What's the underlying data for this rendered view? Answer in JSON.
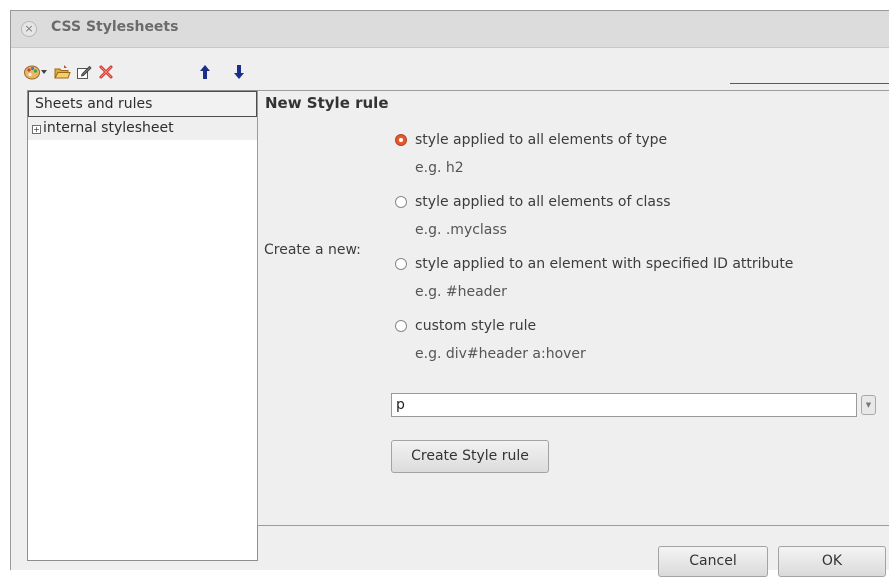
{
  "window": {
    "title": "CSS Stylesheets",
    "close_glyph": "×"
  },
  "toolbar": {
    "icons": [
      "palette-icon",
      "dropdown-arrow-icon",
      "open-folder-icon",
      "edit-icon",
      "delete-icon",
      "move-up-icon",
      "move-down-icon"
    ]
  },
  "tree": {
    "header": "Sheets and rules",
    "items": [
      {
        "label": "internal stylesheet",
        "expander": "+"
      }
    ]
  },
  "form": {
    "title": "New Style rule",
    "create_label": "Create a new:",
    "options": [
      {
        "label": "style applied to all elements of type",
        "example": "e.g. h2",
        "selected": true
      },
      {
        "label": "style applied to all elements of class",
        "example": "e.g. .myclass",
        "selected": false
      },
      {
        "label": "style applied to an element with specified ID attribute",
        "example": "e.g. #header",
        "selected": false
      },
      {
        "label": "custom style rule",
        "example": "e.g. div#header a:hover",
        "selected": false
      }
    ],
    "selector_value": "p",
    "create_button": "Create Style rule"
  },
  "buttons": {
    "cancel": "Cancel",
    "ok": "OK"
  },
  "colors": {
    "radio_selected": "#e35b2c",
    "title_bar": "#dcdcdc",
    "dialog_bg": "#efefef"
  }
}
